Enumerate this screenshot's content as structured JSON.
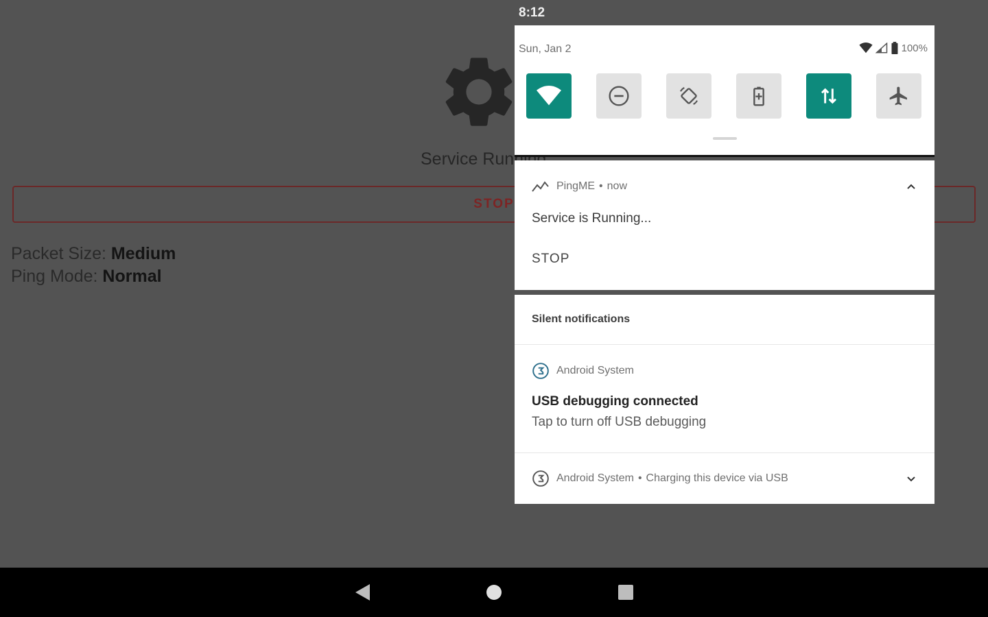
{
  "statusbar": {
    "time": "8:12"
  },
  "app": {
    "service_status": "Service Running",
    "stop_button": "STOP",
    "packet_size_label": "Packet Size:",
    "packet_size_value": "Medium",
    "ping_mode_label": "Ping Mode:",
    "ping_mode_value": "Normal"
  },
  "quick_settings": {
    "date": "Sun, Jan 2",
    "battery": "100%",
    "tiles": [
      {
        "icon": "wifi-icon",
        "active": true
      },
      {
        "icon": "do-not-disturb-icon",
        "active": false
      },
      {
        "icon": "auto-rotate-icon",
        "active": false
      },
      {
        "icon": "battery-saver-icon",
        "active": false
      },
      {
        "icon": "mobile-data-icon",
        "active": true
      },
      {
        "icon": "airplane-mode-icon",
        "active": false
      }
    ],
    "accent": "#0d8a7c"
  },
  "notifications": {
    "pingme": {
      "app_name": "PingME",
      "separator": "•",
      "time": "now",
      "text": "Service is Running...",
      "action": "STOP"
    },
    "silent": {
      "header": "Silent notifications",
      "usb_debug": {
        "app_name": "Android System",
        "title": "USB debugging connected",
        "subtitle": "Tap to turn off USB debugging"
      },
      "charging": {
        "app_name": "Android System",
        "separator": "•",
        "text": "Charging this device via USB"
      }
    }
  }
}
